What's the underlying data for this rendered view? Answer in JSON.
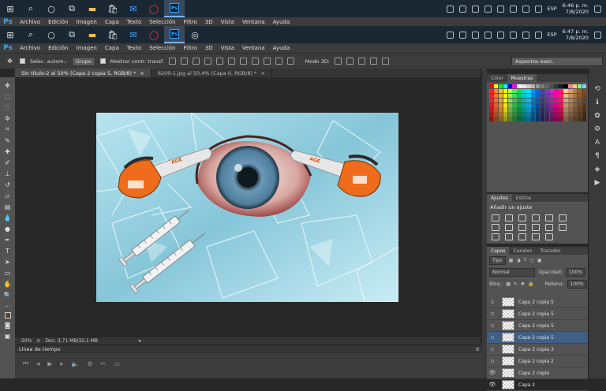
{
  "taskbar_top": {
    "lang": "ESP",
    "time": "6:46 p. m.",
    "date": "7/8/2020"
  },
  "taskbar_bottom": {
    "lang": "ESP",
    "time": "6:47 p. m.",
    "date": "7/8/2020"
  },
  "menu1": [
    "Archivo",
    "Edición",
    "Imagen",
    "Capa",
    "Texto",
    "Selección",
    "Filtro",
    "3D",
    "Vista",
    "Ventana",
    "Ayuda"
  ],
  "menu2": [
    "Archivo",
    "Edición",
    "Imagen",
    "Capa",
    "Texto",
    "Selección",
    "Filtro",
    "3D",
    "Vista",
    "Ventana",
    "Ayuda"
  ],
  "options": {
    "auto_select": "Selec. autom.:",
    "group": "Grupo",
    "show_transform": "Mostrar contr. transf.",
    "mode3d": "Modo 3D:",
    "workspace": "Aspectos esen."
  },
  "tabs": [
    {
      "label": "Sin título-2 al 50% (Capa 2 copia 5, RGB/8) *"
    },
    {
      "label": "6200-1.jpg al 50,4% (Capa 0, RGB/8) *"
    }
  ],
  "status": {
    "zoom": "50%",
    "doc": "Doc: 3,71 MB/32,1 MB"
  },
  "timeline": {
    "title": "Línea de tiempo"
  },
  "color_panel": {
    "tabs": [
      "Color",
      "Muestras"
    ]
  },
  "adjust_panel": {
    "tabs": [
      "Ajustes",
      "Estilos"
    ],
    "title": "Añadir un ajuste"
  },
  "layers_panel": {
    "tabs": [
      "Capas",
      "Canales",
      "Trazados"
    ],
    "filter": "Tipo",
    "blend": "Normal",
    "opacity_label": "Opacidad:",
    "opacity": "100%",
    "lock_label": "Bloq.:",
    "fill_label": "Relleno:",
    "fill": "100%",
    "layers": [
      {
        "name": "Capa 2 copia 5",
        "selected": false,
        "visible": false
      },
      {
        "name": "Capa 2 copia 5",
        "selected": false,
        "visible": false
      },
      {
        "name": "Capa 2 copia 5",
        "selected": false,
        "visible": false
      },
      {
        "name": "Capa 2 copia 5",
        "selected": true,
        "visible": false
      },
      {
        "name": "Capa 2 copia 3",
        "selected": false,
        "visible": false
      },
      {
        "name": "Capa 2 copia 2",
        "selected": false,
        "visible": false
      },
      {
        "name": "Capa 2 copia",
        "selected": false,
        "visible": true
      },
      {
        "name": "Capa 2",
        "selected": false,
        "visible": true
      }
    ]
  },
  "canvas_art": {
    "chainsaw_brand": "AGE",
    "eye_color": "#4f7f9c"
  }
}
